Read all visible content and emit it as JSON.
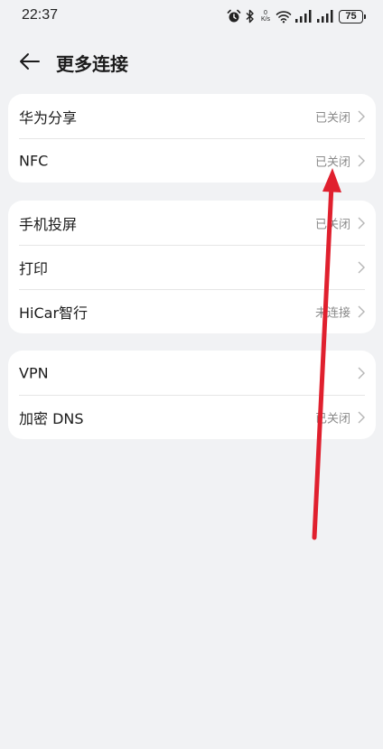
{
  "status_bar": {
    "time": "22:37",
    "network_speed_value": "0",
    "network_speed_unit": "K/s",
    "battery": "75"
  },
  "header": {
    "title": "更多连接"
  },
  "groups": [
    {
      "items": [
        {
          "label": "华为分享",
          "value": "已关闭"
        },
        {
          "label": "NFC",
          "value": "已关闭"
        }
      ]
    },
    {
      "items": [
        {
          "label": "手机投屏",
          "value": "已关闭"
        },
        {
          "label": "打印",
          "value": ""
        },
        {
          "label": "HiCar智行",
          "value": "未连接"
        }
      ]
    },
    {
      "items": [
        {
          "label": "VPN",
          "value": ""
        },
        {
          "label": "加密 DNS",
          "value": "已关闭"
        }
      ]
    }
  ],
  "colors": {
    "background": "#f1f2f4",
    "card": "#ffffff",
    "annotation_arrow": "#e0202e",
    "secondary_text": "#8a8a8a"
  },
  "icons": [
    "alarm-icon",
    "bluetooth-icon",
    "wifi-icon",
    "signal-icon",
    "battery-icon",
    "back-arrow-icon",
    "chevron-right-icon"
  ]
}
